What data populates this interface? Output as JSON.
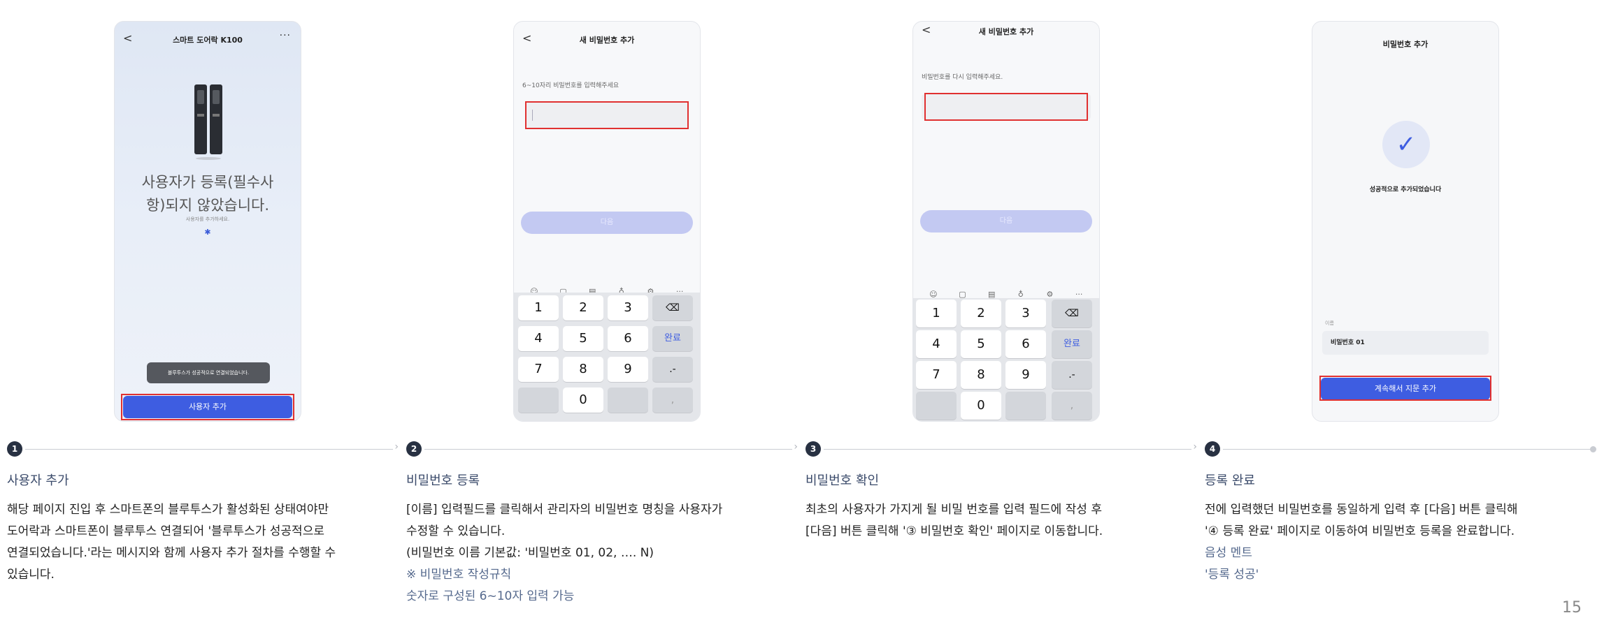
{
  "screens": {
    "s1": {
      "title": "스마트 도어락 K100",
      "back": "<",
      "more": "···",
      "message_lines": [
        "사용자가 등록(필수사",
        "항)되지 않았습니다."
      ],
      "sub_message": "사용자를 추가하세요.",
      "bluetooth_icon": "bluetooth-icon",
      "toast": "블루투스가 성공적으로 연결되었습니다.",
      "button": "사용자 추가"
    },
    "s2": {
      "title": "새 비밀번호 추가",
      "back": "<",
      "prompt": "6~10자리 비밀번호를 입력해주세요",
      "next": "다음"
    },
    "s3": {
      "title": "새 비밀번호 추가",
      "back": "<",
      "prompt": "비밀번호를 다시 입력해주세요.",
      "next": "다음"
    },
    "s4": {
      "title": "비밀번호 추가",
      "success": "성공적으로 추가되었습니다",
      "name_label": "이름",
      "name_value": "비밀번호 01",
      "button": "계속해서 지문 추가"
    }
  },
  "keypad": {
    "keys": [
      "1",
      "2",
      "3",
      "4",
      "5",
      "6",
      "7",
      "8",
      "9",
      "",
      "0",
      ","
    ],
    "done": "완료",
    "punct": ".-",
    "backspace": "⌫",
    "toolbar_icons": [
      "☺",
      "▢",
      "▤",
      "♁",
      "⚙",
      "···"
    ]
  },
  "steps": [
    {
      "number": "1",
      "title": "사용자 추가",
      "lines": [
        "해당 페이지 진입 후 스마트폰의 블루투스가 활성화된 상태여야만",
        "도어락과 스마트폰이 블루투스 연결되어 '블루투스가 성공적으로",
        "연결되었습니다.'라는 메시지와 함께 사용자 추가 절차를 수행할 수",
        "있습니다."
      ],
      "notes": []
    },
    {
      "number": "2",
      "title": "비밀번호 등록",
      "lines": [
        "[이름] 입력필드를 클릭해서 관리자의 비밀번호 명칭을 사용자가",
        "수정할 수 있습니다.",
        "(비밀번호 이름 기본값: '비밀번호 01, 02, …. N)"
      ],
      "notes": [
        "※ 비밀번호 작성규칙",
        "숫자로 구성된 6~10자 입력 가능"
      ]
    },
    {
      "number": "3",
      "title": "비밀번호 확인",
      "lines": [
        "최초의 사용자가 가지게 될 비밀 번호를 입력 필드에 작성 후",
        "[다음] 버튼 클릭해 '③ 비밀번호 확인' 페이지로 이동합니다."
      ],
      "notes": []
    },
    {
      "number": "4",
      "title": "등록 완료",
      "lines": [
        "전에 입력했던 비밀번호를 동일하게 입력 후 [다음] 버튼 클릭해",
        "'④ 등록 완료' 페이지로 이동하여 비밀번호 등록을 완료합니다."
      ],
      "notes": [
        "음성 멘트",
        "'등록 성공'"
      ]
    }
  ],
  "page_number": "15",
  "colors": {
    "accent": "#3e5de1",
    "highlight_box": "#e03030",
    "step_title": "#3a4a6a",
    "note_text": "#55698d"
  }
}
